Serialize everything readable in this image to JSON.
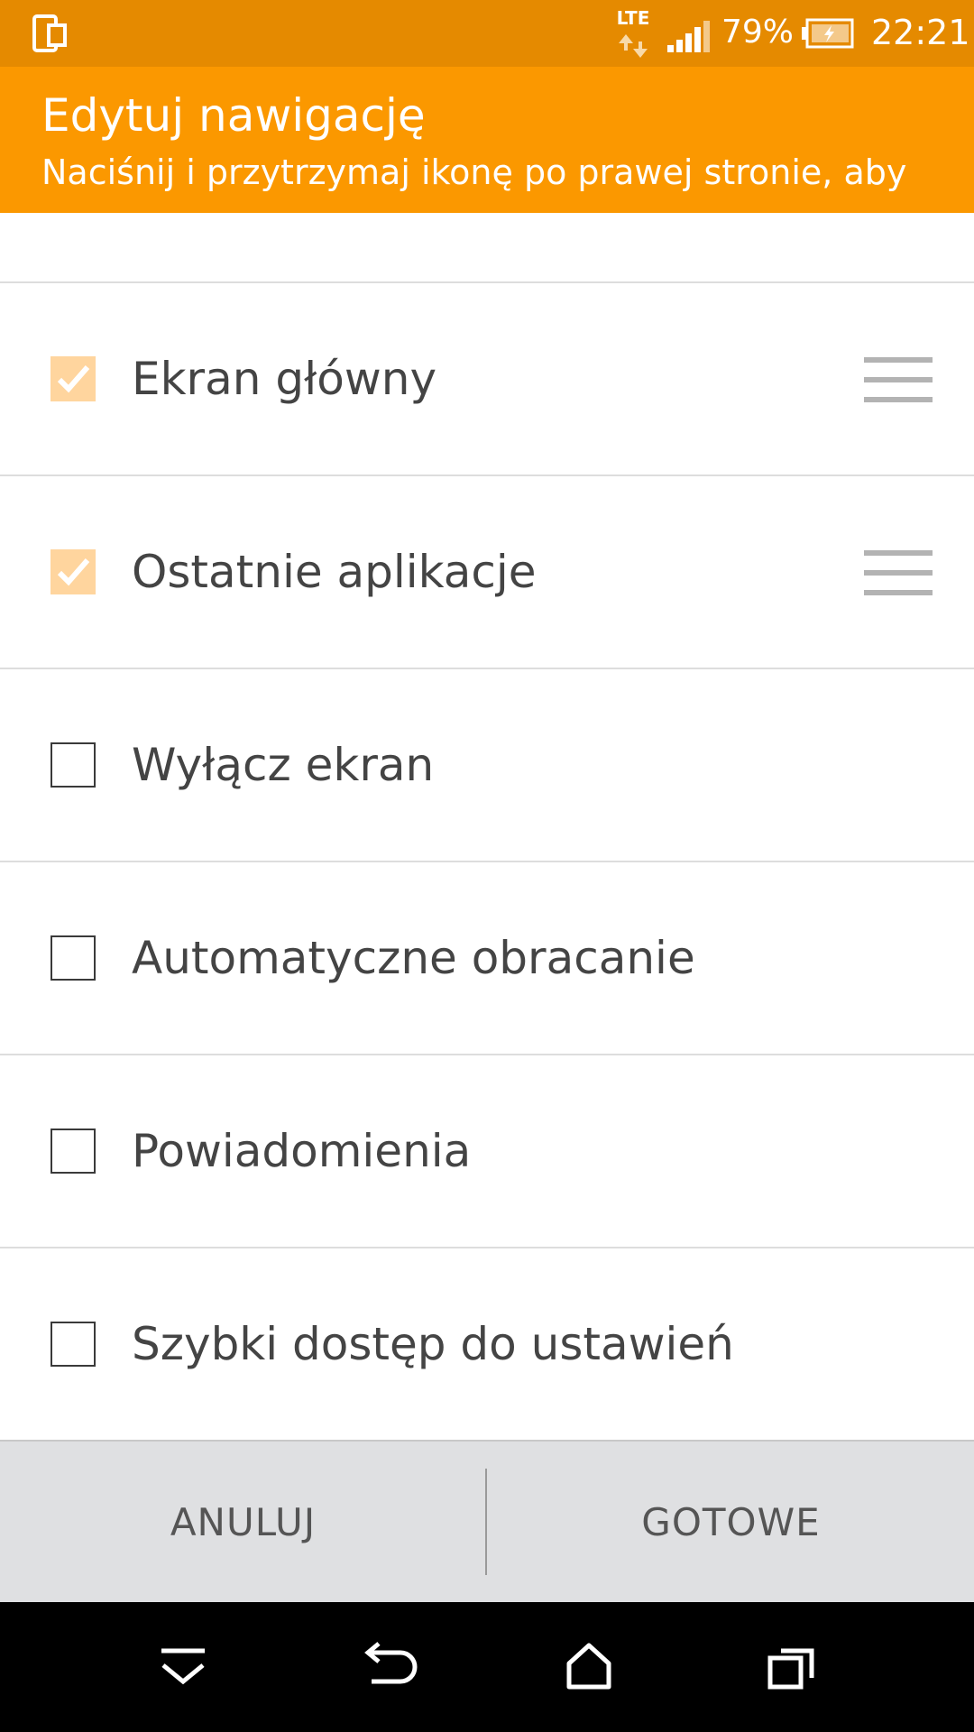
{
  "status_bar": {
    "network_type": "LTE",
    "battery_percent": "79%",
    "time": "22:21",
    "icons": [
      "screen-share-icon",
      "lte-data-icon",
      "signal-icon",
      "battery-charging-icon"
    ]
  },
  "header": {
    "title": "Edytuj nawigację",
    "subtitle": "Naciśnij i przytrzymaj ikonę po prawej stronie, aby"
  },
  "items": [
    {
      "label": "Ekran główny",
      "checked": true,
      "draggable": true
    },
    {
      "label": "Ostatnie aplikacje",
      "checked": true,
      "draggable": true
    },
    {
      "label": "Wyłącz ekran",
      "checked": false,
      "draggable": false
    },
    {
      "label": "Automatyczne obracanie",
      "checked": false,
      "draggable": false
    },
    {
      "label": "Powiadomienia",
      "checked": false,
      "draggable": false
    },
    {
      "label": "Szybki dostęp do ustawień",
      "checked": false,
      "draggable": false
    }
  ],
  "actions": {
    "cancel": "ANULUJ",
    "done": "GOTOWE"
  },
  "nav_bar": {
    "icons": [
      "hide-nav-icon",
      "back-icon",
      "home-icon",
      "recents-icon"
    ]
  },
  "colors": {
    "status_bar": "#e58a00",
    "header": "#fb9800",
    "checkbox_checked": "#ffd59e",
    "action_bar": "#dfe0e2"
  }
}
